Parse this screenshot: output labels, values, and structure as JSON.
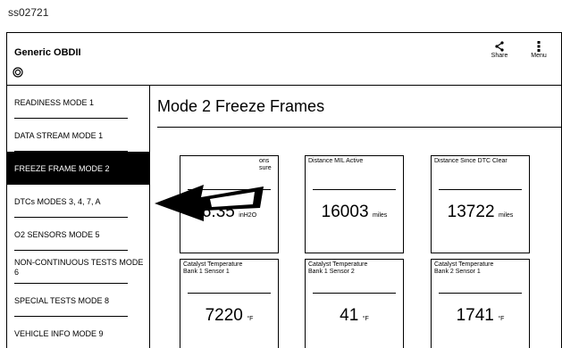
{
  "screenshot_id": "ss02721",
  "app": {
    "title": "Generic OBDII",
    "actions": [
      {
        "label": "Share",
        "icon": "share-icon"
      },
      {
        "label": "Menu",
        "icon": "more-vert-icon"
      }
    ]
  },
  "sidebar": {
    "items": [
      {
        "label": "READINESS MODE 1",
        "active": false
      },
      {
        "label": "DATA STREAM MODE 1",
        "active": false
      },
      {
        "label": "FREEZE FRAME MODE 2",
        "active": true
      },
      {
        "label": "DTCs MODES 3, 4, 7, A",
        "active": false
      },
      {
        "label": "O2 SENSORS MODE 5",
        "active": false
      },
      {
        "label": "NON-CONTINUOUS TESTS MODE 6",
        "active": false
      },
      {
        "label": "SPECIAL TESTS MODE 8",
        "active": false
      },
      {
        "label": "VEHICLE INFO MODE 9",
        "active": false
      }
    ]
  },
  "main": {
    "title": "Mode 2 Freeze Frames",
    "cards": [
      {
        "label": "ons\nsure",
        "value": "6.35",
        "unit": "inH2O"
      },
      {
        "label": "Distance MIL Active",
        "value": "16003",
        "unit": "miles"
      },
      {
        "label": "Distance Since DTC Clear",
        "value": "13722",
        "unit": "miles"
      },
      {
        "label": "Catalyst Temperature\nBank 1 Sensor 1",
        "value": "7220",
        "unit": "°F"
      },
      {
        "label": "Catalyst Temperature\nBank 1 Sensor 2",
        "value": "41",
        "unit": "°F"
      },
      {
        "label": "Catalyst Temperature\nBank 2 Sensor 1",
        "value": "1741",
        "unit": "°F"
      }
    ]
  },
  "colors": {
    "background": "#ffffff",
    "foreground": "#000000",
    "active_item": "#000000"
  }
}
